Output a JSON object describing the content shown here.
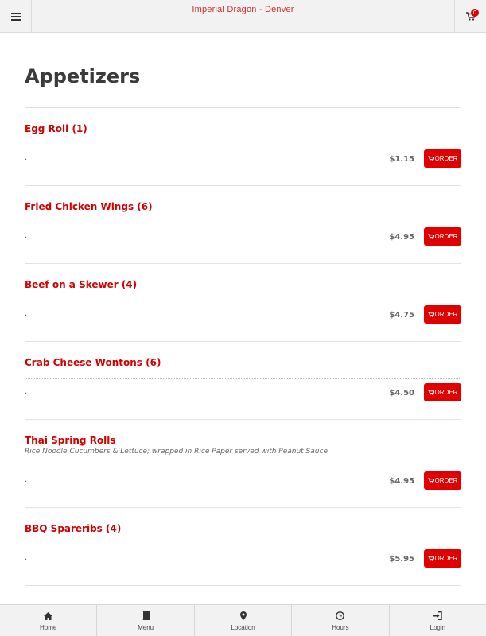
{
  "header": {
    "title": "Imperial Dragon - Denver",
    "cart_count": "0",
    "menu_icon": "hamburger-icon",
    "cart_icon": "cart-icon"
  },
  "section": {
    "title": "Appetizers"
  },
  "items": [
    {
      "name": "Egg Roll (1)",
      "description": "",
      "dot": ".",
      "price": "$1.15",
      "order_label": "ORDER"
    },
    {
      "name": "Fried Chicken Wings (6)",
      "description": "",
      "dot": ".",
      "price": "$4.95",
      "order_label": "ORDER"
    },
    {
      "name": "Beef on a Skewer (4)",
      "description": "",
      "dot": ".",
      "price": "$4.75",
      "order_label": "ORDER"
    },
    {
      "name": "Crab Cheese Wontons (6)",
      "description": "",
      "dot": ".",
      "price": "$4.50",
      "order_label": "ORDER"
    },
    {
      "name": "Thai Spring Rolls",
      "description": "Rice Noodle Cucumbers & Lettuce; wrapped in Rice Paper served with Peanut Sauce",
      "dot": ".",
      "price": "$4.95",
      "order_label": "ORDER"
    },
    {
      "name": "BBQ Spareribs (4)",
      "description": "",
      "dot": ".",
      "price": "$5.95",
      "order_label": "ORDER"
    }
  ],
  "bottom_nav": [
    {
      "label": "Home",
      "icon": "home-icon"
    },
    {
      "label": "Menu",
      "icon": "book-icon"
    },
    {
      "label": "Location",
      "icon": "map-marker-icon"
    },
    {
      "label": "Hours",
      "icon": "clock-icon"
    },
    {
      "label": "Login",
      "icon": "login-icon"
    }
  ],
  "colors": {
    "accent": "#d40000",
    "button": "#e10000",
    "bar_bg": "#f2f2f2"
  }
}
